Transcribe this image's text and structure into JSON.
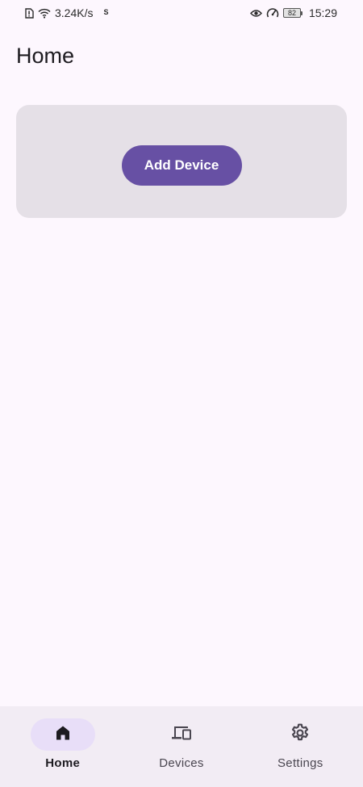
{
  "status_bar": {
    "network_speed": "3.24K/s",
    "small_indicator": "S",
    "battery_level": "82",
    "time": "15:29",
    "icons": [
      "alert-sim-icon",
      "wifi-icon",
      "eye-icon",
      "speed-icon",
      "battery-icon"
    ]
  },
  "page": {
    "title": "Home"
  },
  "card": {
    "add_device_label": "Add Device"
  },
  "bottom_nav": {
    "items": [
      {
        "label": "Home",
        "icon": "home-icon",
        "active": true
      },
      {
        "label": "Devices",
        "icon": "devices-icon",
        "active": false
      },
      {
        "label": "Settings",
        "icon": "gear-icon",
        "active": false
      }
    ]
  },
  "colors": {
    "background": "#FDF7FE",
    "card": "#E5E0E7",
    "primary": "#6750A4",
    "nav_background": "#F2ECF4",
    "nav_active_indicator": "#E8DEF8"
  }
}
